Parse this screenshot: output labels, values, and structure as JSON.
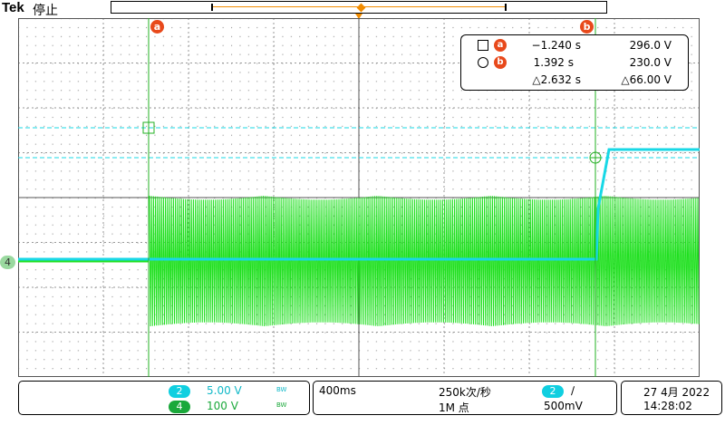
{
  "header": {
    "brand": "Tek",
    "state": "停止"
  },
  "cursors": {
    "a": {
      "label": "a"
    },
    "b": {
      "label": "b"
    }
  },
  "channel_marker": "4",
  "readout": {
    "a": {
      "label": "a",
      "time": "−1.240 s",
      "value": "296.0 V"
    },
    "b": {
      "label": "b",
      "time": "1.392 s",
      "value": "230.0 V"
    },
    "delta_time": "△2.632 s",
    "delta_value": "△66.00 V"
  },
  "channels": [
    {
      "num": "2",
      "scale": "5.00 V",
      "color": "#10cfe0"
    },
    {
      "num": "4",
      "scale": "100 V",
      "color": "#1aa83a"
    }
  ],
  "bw_label": "BW",
  "timebase": {
    "scale": "400ms",
    "sample_rate": "250k次/秒",
    "record_length": "1M 点",
    "trigger_source": "2",
    "trigger_slope": "∕",
    "trigger_level": "500mV"
  },
  "datetime": {
    "date": "27 4月 2022",
    "time": "14:28:02"
  },
  "colors": {
    "ch2_trace": "#18d8e6",
    "ch4_trace": "#1fe01f",
    "cursor": "#22b022",
    "accent": "#f28c00",
    "flag": "#e8491b"
  }
}
